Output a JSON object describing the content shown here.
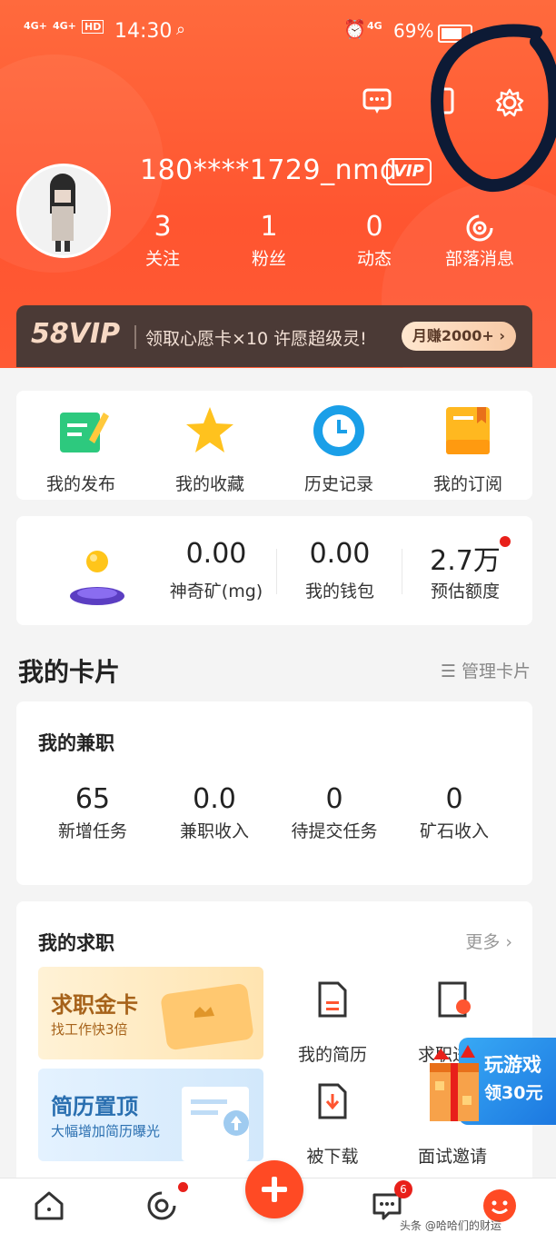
{
  "status_bar": {
    "signal1": "4G+",
    "signal2": "4G+",
    "hd": "HD",
    "time": "14:30",
    "network": "4G",
    "battery": "69%"
  },
  "profile": {
    "username": "180****1729_nmd",
    "vip_tag": "VIP",
    "stats": [
      {
        "value": "3",
        "label": "关注"
      },
      {
        "value": "1",
        "label": "粉丝"
      },
      {
        "value": "0",
        "label": "动态"
      },
      {
        "value": "",
        "label": "部落消息"
      }
    ]
  },
  "vip_banner": {
    "logo": "58VIP",
    "text": "领取心愿卡×10 许愿超级灵!",
    "pill": "月赚2000+ ›"
  },
  "quick_actions": [
    {
      "label": "我的发布",
      "icon": "publish-icon"
    },
    {
      "label": "我的收藏",
      "icon": "star-icon"
    },
    {
      "label": "历史记录",
      "icon": "clock-icon"
    },
    {
      "label": "我的订阅",
      "icon": "subscription-icon"
    }
  ],
  "finance": [
    {
      "value": "0.00",
      "label": "神奇矿(mg)"
    },
    {
      "value": "0.00",
      "label": "我的钱包"
    },
    {
      "value": "2.7万",
      "label": "预估额度"
    }
  ],
  "cards_section": {
    "title": "我的卡片",
    "manage": "☰ 管理卡片"
  },
  "part_time": {
    "title": "我的兼职",
    "stats": [
      {
        "value": "65",
        "label": "新增任务"
      },
      {
        "value": "0.0",
        "label": "兼职收入"
      },
      {
        "value": "0",
        "label": "待提交任务"
      },
      {
        "value": "0",
        "label": "矿石收入"
      }
    ]
  },
  "job_search": {
    "title": "我的求职",
    "more": "更多 ›",
    "promo1": {
      "title": "求职金卡",
      "subtitle": "找工作快3倍"
    },
    "promo2": {
      "title": "简历置顶",
      "subtitle": "大幅增加简历曝光"
    },
    "items": [
      {
        "label": "我的简历",
        "icon": "resume-icon"
      },
      {
        "label": "求职进程",
        "icon": "progress-icon"
      },
      {
        "label": "被下载",
        "icon": "download-icon"
      },
      {
        "label": "面试邀请",
        "icon": "interview-icon"
      }
    ]
  },
  "game_float": {
    "line1": "玩游戏",
    "line2": "领30元"
  },
  "bottom_nav": {
    "message_badge": "6",
    "watermark": "头条 @哈哈们的财运"
  },
  "colors": {
    "brand": "#ff5530",
    "vip_dark": "#4b3a36",
    "badge": "#e8201a"
  }
}
